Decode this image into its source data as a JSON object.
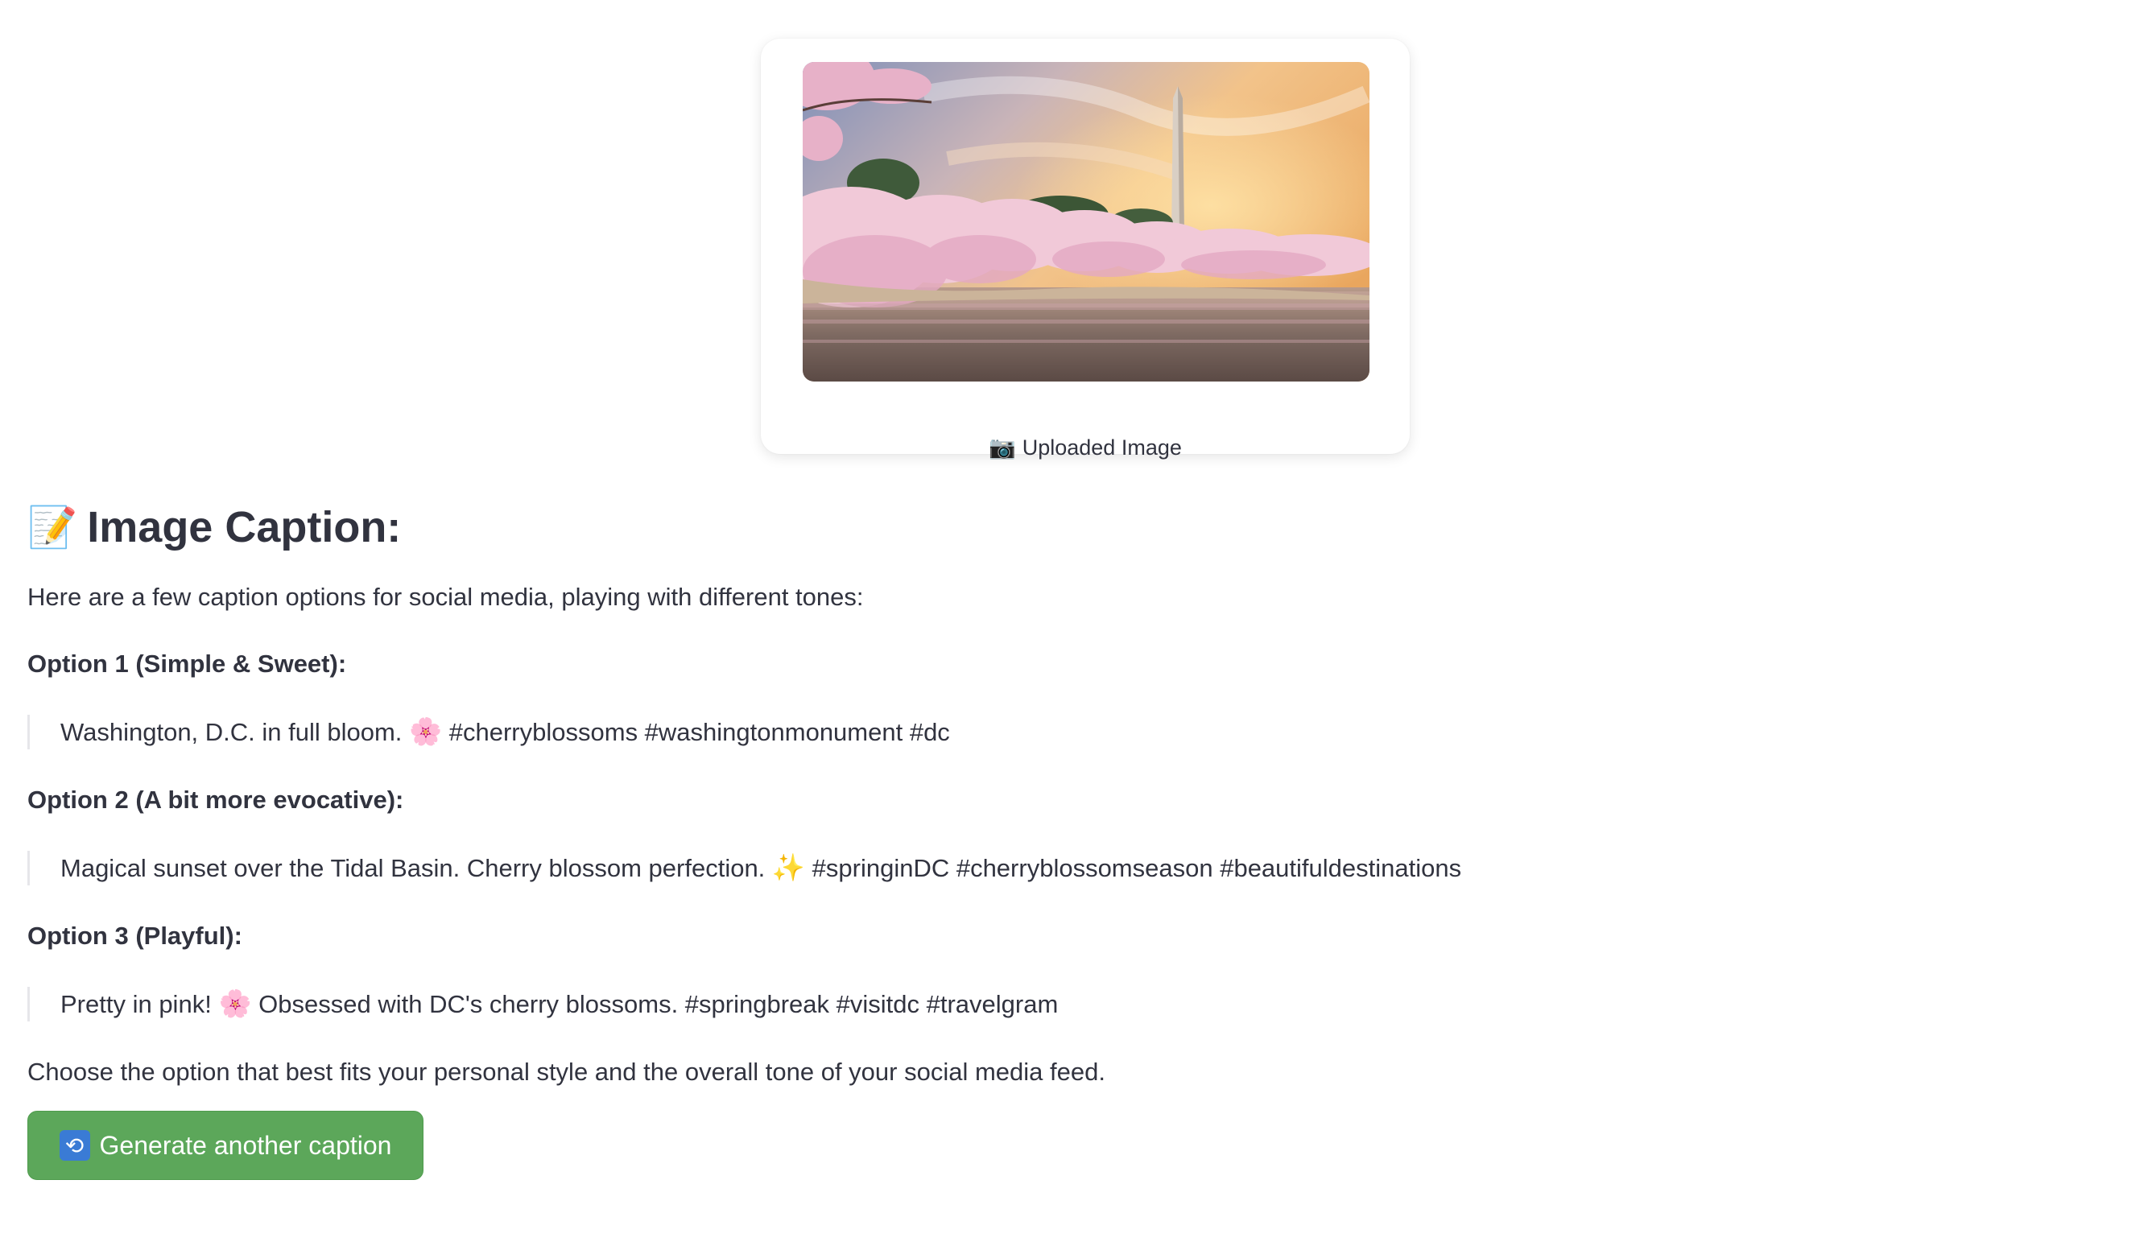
{
  "image_card": {
    "caption_icon": "📷",
    "caption": "Uploaded Image"
  },
  "caption_section": {
    "heading_icon": "📝",
    "heading": "Image Caption:",
    "intro": "Here are a few caption options for social media, playing with different tones:",
    "options": [
      {
        "title": "Option 1 (Simple & Sweet):",
        "before_emoji": "Washington, D.C. in full bloom.",
        "emoji": "🌸",
        "after_emoji": "#cherryblossoms #washingtonmonument #dc"
      },
      {
        "title": "Option 2 (A bit more evocative):",
        "before_emoji": "Magical sunset over the Tidal Basin. Cherry blossom perfection.",
        "emoji": "✨",
        "after_emoji": "#springinDC #cherryblossomseason #beautifuldestinations"
      },
      {
        "title": "Option 3 (Playful):",
        "before_emoji": "Pretty in pink!",
        "emoji": "🌸",
        "after_emoji": "Obsessed with DC's cherry blossoms. #springbreak #visitdc #travelgram"
      }
    ],
    "closing": "Choose the option that best fits your personal style and the overall tone of your social media feed."
  },
  "button": {
    "icon": "repeat-icon",
    "icon_glyph": "🔁",
    "label": "Generate another caption",
    "color": "#5ca75a"
  }
}
